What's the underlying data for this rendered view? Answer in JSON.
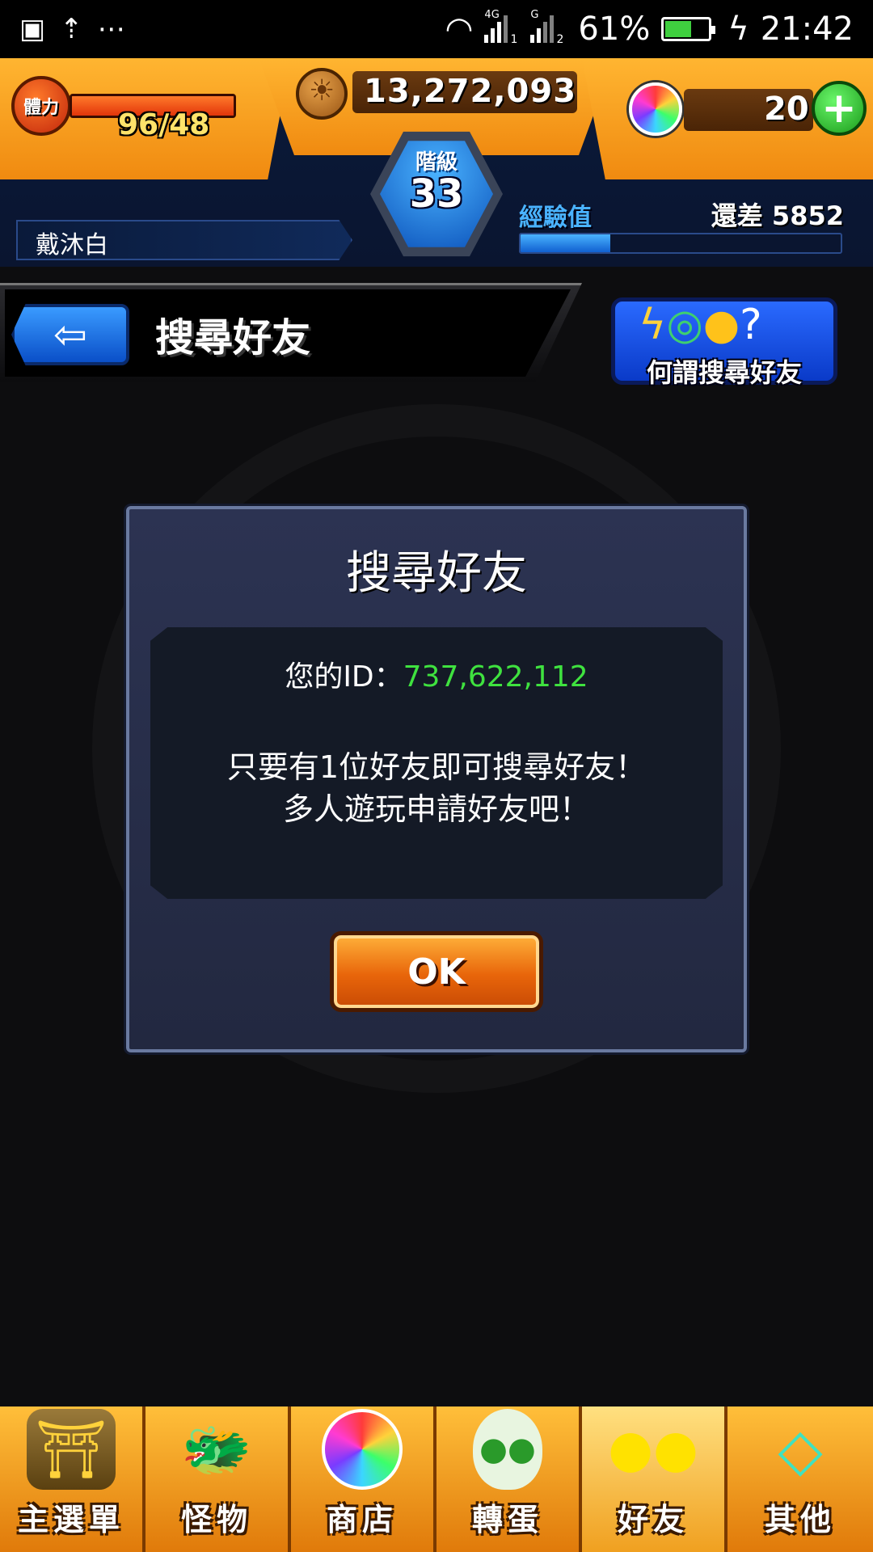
{
  "status_bar": {
    "signal_1_label": "4G",
    "signal_1_sub": "1",
    "signal_2_label": "G",
    "signal_2_sub": "2",
    "battery": "61%",
    "battery_level": 0.61,
    "time": "21:42",
    "icons": [
      "notification-icon",
      "upload-icon",
      "more-icon",
      "wifi-icon",
      "signal-icon",
      "battery-icon",
      "charging-icon"
    ]
  },
  "hud": {
    "stamina_label": "體力",
    "stamina_value": "96/48",
    "stamina_level": 1.0,
    "gold": "13,272,093",
    "orbs": "20",
    "plus_label": "+",
    "rank_label": "階級",
    "rank_value": "33",
    "player_name": "戴沐白",
    "exp_label": "經驗值",
    "exp_remaining": "還差 5852",
    "exp_progress": 0.28,
    "colors": {
      "orange": "#f08a10",
      "blue": "#0a4fb8",
      "green": "#1a9a1a"
    }
  },
  "header": {
    "title": "搜尋好友",
    "back_icon": "back-arrow-icon",
    "help_label": "何謂搜尋好友"
  },
  "dialog": {
    "title": "搜尋好友",
    "id_label": "您的ID：",
    "id_value": "737,622,112",
    "message_line1": "只要有1位好友即可搜尋好友！",
    "message_line2": "多人遊玩申請好友吧！",
    "ok_label": "OK",
    "id_color": "#3fe23f"
  },
  "bottom_nav": {
    "items": [
      {
        "label": "主選單",
        "icon": "gate-icon"
      },
      {
        "label": "怪物",
        "icon": "monster-icon"
      },
      {
        "label": "商店",
        "icon": "orb-icon"
      },
      {
        "label": "轉蛋",
        "icon": "egg-icon"
      },
      {
        "label": "好友",
        "icon": "friends-icon"
      },
      {
        "label": "其他",
        "icon": "other-icon"
      }
    ],
    "active_index": 4
  }
}
